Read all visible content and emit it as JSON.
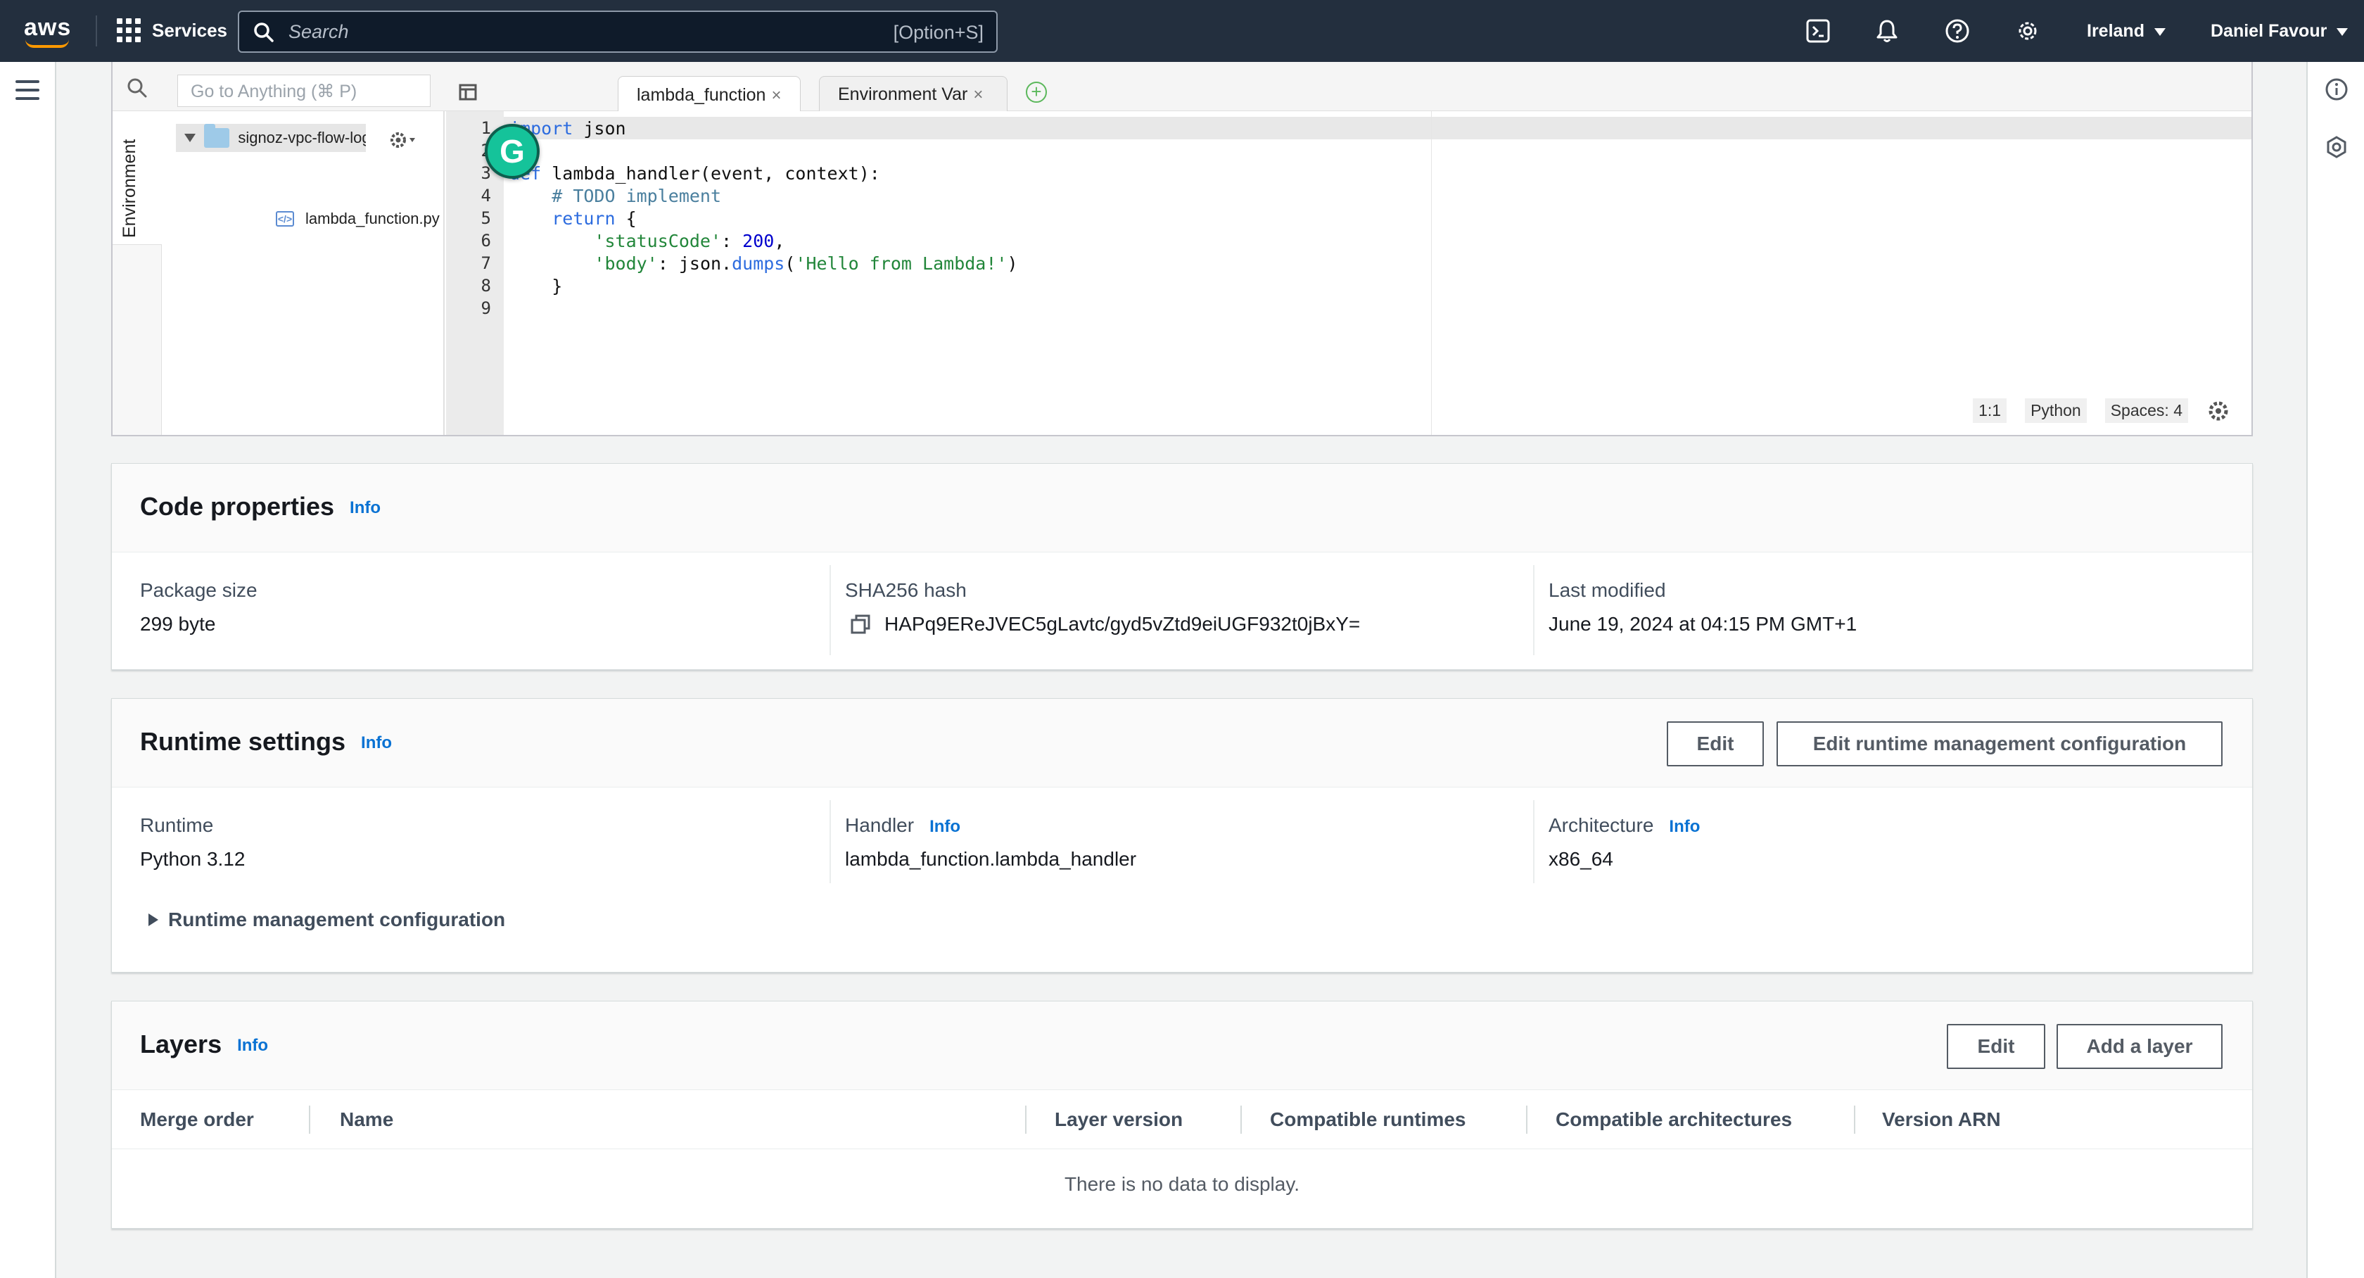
{
  "nav": {
    "logo": "aws",
    "services": "Services",
    "search_placeholder": "Search",
    "search_shortcut": "[Option+S]",
    "region": "Ireland",
    "user": "Daniel Favour"
  },
  "editor": {
    "goto_placeholder": "Go to Anything (⌘ P)",
    "tabs": [
      {
        "label": "lambda_function"
      },
      {
        "label": "Environment Var"
      }
    ],
    "close_glyph": "×",
    "environment_label": "Environment",
    "folder_name": "signoz-vpc-flow-logs",
    "file_name": "lambda_function.py",
    "line_numbers": [
      "1",
      "2",
      "3",
      "4",
      "5",
      "6",
      "7",
      "8",
      "9"
    ],
    "status": {
      "position": "1:1",
      "language": "Python",
      "spaces": "Spaces: 4"
    }
  },
  "code_properties": {
    "title": "Code properties",
    "info": "Info",
    "package_size_label": "Package size",
    "package_size": "299 byte",
    "sha_label": "SHA256 hash",
    "sha": "HAPq9EReJVEC5gLavtc/gyd5vZtd9eiUGF932t0jBxY=",
    "modified_label": "Last modified",
    "modified": "June 19, 2024 at 04:15 PM GMT+1"
  },
  "runtime_settings": {
    "title": "Runtime settings",
    "info": "Info",
    "edit_label": "Edit",
    "edit_runtime_mgmt_label": "Edit runtime management configuration",
    "runtime_label": "Runtime",
    "runtime": "Python 3.12",
    "handler_label": "Handler",
    "handler": "lambda_function.lambda_handler",
    "arch_label": "Architecture",
    "arch": "x86_64",
    "runtime_mgmt_expander": "Runtime management configuration"
  },
  "layers": {
    "title": "Layers",
    "info": "Info",
    "edit_label": "Edit",
    "add_label": "Add a layer",
    "columns": [
      "Merge order",
      "Name",
      "Layer version",
      "Compatible runtimes",
      "Compatible architectures",
      "Version ARN"
    ],
    "empty": "There is no data to display."
  },
  "colors": {
    "nav_bg": "#232f3e",
    "accent": "#ff9900",
    "link": "#0972d3"
  }
}
